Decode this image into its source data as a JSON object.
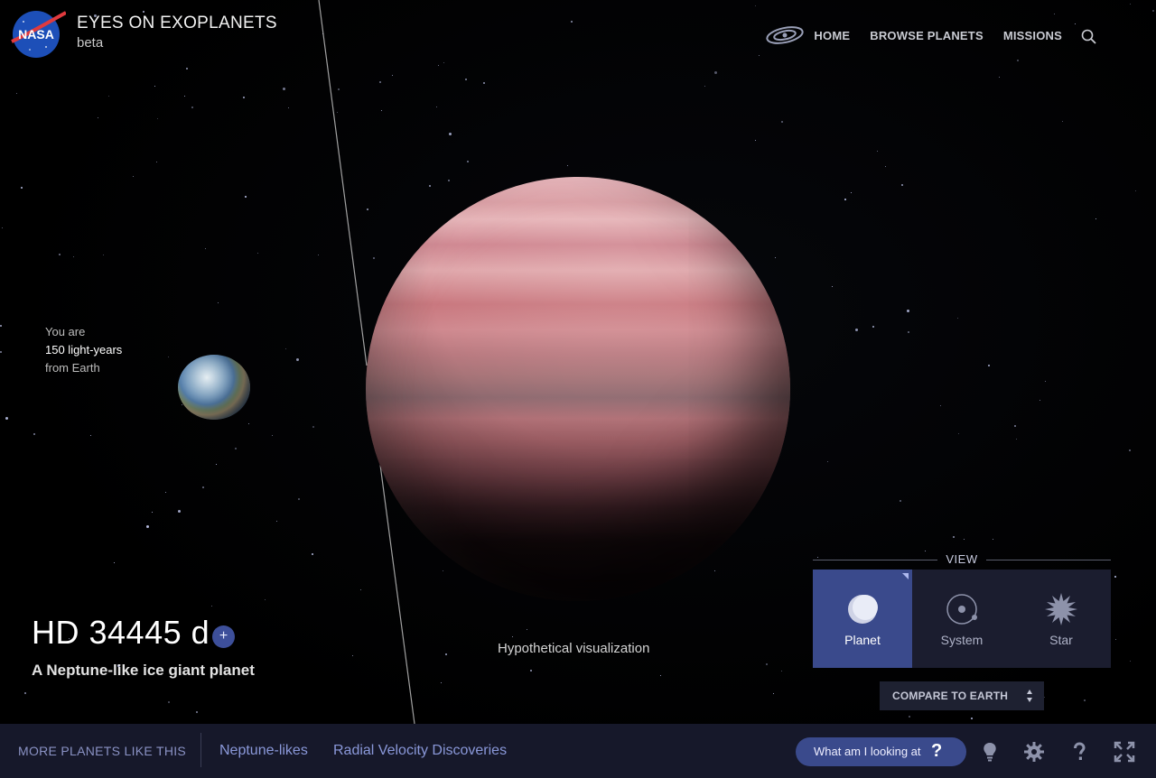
{
  "header": {
    "title": "EYES ON EXOPLANETS",
    "subtitle": "beta",
    "logo": {
      "icon": "nasa-logo",
      "text": "NASA"
    },
    "nav": [
      {
        "label": "HOME"
      },
      {
        "label": "BROWSE PLANETS"
      },
      {
        "label": "MISSIONS"
      }
    ],
    "galaxy_icon": "galaxy-icon",
    "search_icon": "search-icon"
  },
  "distance": {
    "line1": "You are",
    "line2": "150 light-years",
    "line3": "from Earth"
  },
  "planet": {
    "name": "HD 34445 d",
    "add_label": "+",
    "description": "A Neptune-like ice giant planet",
    "visualization_note": "Hypothetical visualization"
  },
  "view": {
    "label": "VIEW",
    "options": [
      {
        "label": "Planet",
        "icon": "planet-icon",
        "active": true
      },
      {
        "label": "System",
        "icon": "system-icon",
        "active": false
      },
      {
        "label": "Star",
        "icon": "star-icon",
        "active": false
      }
    ],
    "compare_label": "COMPARE TO EARTH"
  },
  "bottom_bar": {
    "more_label": "MORE PLANETS LIKE THIS",
    "links": [
      {
        "label": "Neptune-likes"
      },
      {
        "label": "Radial Velocity Discoveries"
      }
    ],
    "look_label": "What am I looking at",
    "look_mark": "?",
    "icons": [
      "lightbulb-icon",
      "gear-icon",
      "help-icon",
      "fullscreen-icon"
    ]
  },
  "colors": {
    "accent": "#3a4a8c",
    "panel": "#1b1d2f",
    "bar": "#16182a",
    "link": "#8a98d9"
  }
}
